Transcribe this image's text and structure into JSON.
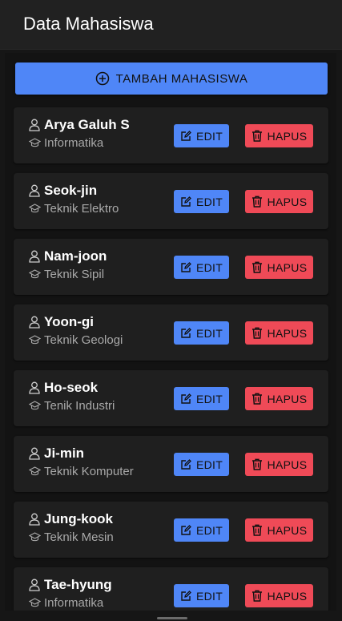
{
  "header": {
    "title": "Data Mahasiswa"
  },
  "add_button": {
    "label": "TAMBAH MAHASISWA"
  },
  "actions": {
    "edit_label": "EDIT",
    "delete_label": "HAPUS"
  },
  "students": [
    {
      "name": "Arya Galuh S",
      "program": "Informatika"
    },
    {
      "name": "Seok-jin",
      "program": "Teknik Elektro"
    },
    {
      "name": "Nam-joon",
      "program": "Teknik Sipil"
    },
    {
      "name": "Yoon-gi",
      "program": "Teknik Geologi"
    },
    {
      "name": "Ho-seok",
      "program": "Tenik Industri"
    },
    {
      "name": "Ji-min",
      "program": "Teknik Komputer"
    },
    {
      "name": "Jung-kook",
      "program": "Teknik Mesin"
    },
    {
      "name": "Tae-hyung",
      "program": "Informatika"
    }
  ],
  "icons": {
    "add": "plus-circle-icon",
    "person": "person-icon",
    "program": "graduation-cap-icon",
    "edit": "edit-icon",
    "delete": "trash-icon"
  },
  "colors": {
    "primary": "#4f86f7",
    "danger": "#ef4a57",
    "card_bg": "#1f1f1f",
    "header_bg": "#212121"
  }
}
